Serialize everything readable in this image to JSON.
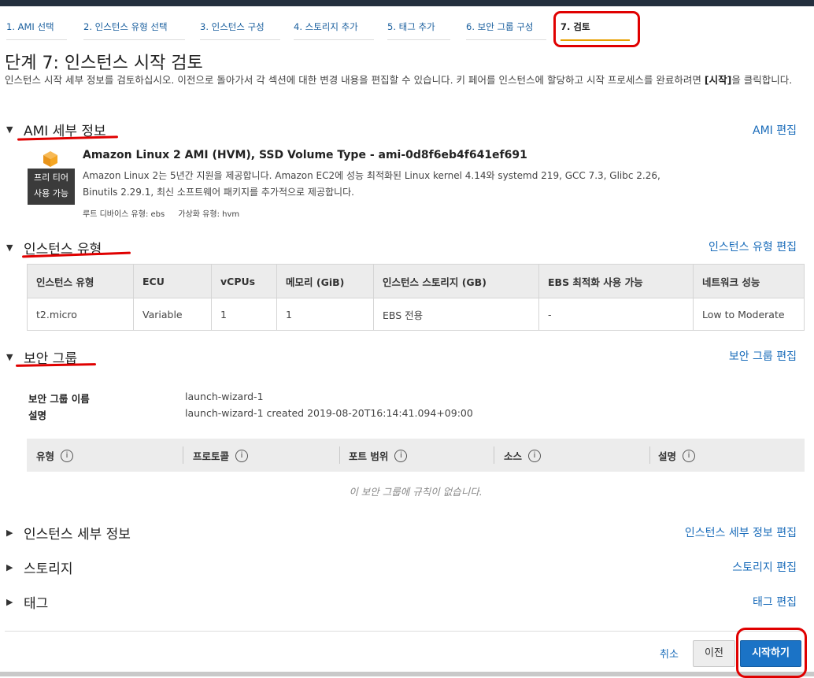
{
  "tabs": [
    {
      "label": "1. AMI 선택"
    },
    {
      "label": "2. 인스턴스 유형 선택"
    },
    {
      "label": "3. 인스턴스 구성"
    },
    {
      "label": "4. 스토리지 추가"
    },
    {
      "label": "5. 태그 추가"
    },
    {
      "label": "6. 보안 그룹 구성"
    },
    {
      "label": "7. 검토"
    }
  ],
  "page": {
    "title": "단계 7: 인스턴스 시작 검토",
    "desc_before": "인스턴스 시작 세부 정보를 검토하십시오. 이전으로 돌아가서 각 섹션에 대한 변경 내용을 편집할 수 있습니다. 키 페어를 인스턴스에 할당하고 시작 프로세스를 완료하려면 ",
    "desc_bold": "[시작]",
    "desc_after": "을 클릭합니다."
  },
  "ami": {
    "heading": "AMI 세부 정보",
    "edit": "AMI 편집",
    "name": "Amazon Linux 2 AMI (HVM), SSD Volume Type - ami-0d8f6eb4f641ef691",
    "free_line1": "프리 티어",
    "free_line2": "사용 가능",
    "description": "Amazon Linux 2는 5년간 지원을 제공합니다. Amazon EC2에 성능 최적화된 Linux kernel 4.14와 systemd 219, GCC 7.3, Glibc 2.26, Binutils 2.29.1, 최신 소프트웨어 패키지를 추가적으로 제공합니다.",
    "root_device": "루트 디바이스 유형: ebs",
    "virtualization": "가상화 유형: hvm"
  },
  "instance_type": {
    "heading": "인스턴스 유형",
    "edit": "인스턴스 유형 편집",
    "columns": [
      "인스턴스 유형",
      "ECU",
      "vCPUs",
      "메모리 (GiB)",
      "인스턴스 스토리지 (GB)",
      "EBS 최적화 사용 가능",
      "네트워크 성능"
    ],
    "row": [
      "t2.micro",
      "Variable",
      "1",
      "1",
      "EBS 전용",
      "-",
      "Low to Moderate"
    ]
  },
  "security": {
    "heading": "보안 그룹",
    "edit": "보안 그룹 편집",
    "name_label": "보안 그룹 이름",
    "name_value": "launch-wizard-1",
    "desc_label": "설명",
    "desc_value": "launch-wizard-1 created 2019-08-20T16:14:41.094+09:00",
    "rule_columns": [
      "유형",
      "프로토콜",
      "포트 범위",
      "소스",
      "설명"
    ],
    "info_glyph": "i",
    "no_rules": "이 보안 그룹에 규칙이 없습니다."
  },
  "collapsed_sections": [
    {
      "heading": "인스턴스 세부 정보",
      "edit": "인스턴스 세부 정보 편집"
    },
    {
      "heading": "스토리지",
      "edit": "스토리지 편집"
    },
    {
      "heading": "태그",
      "edit": "태그 편집"
    }
  ],
  "caret_down": "▼",
  "caret_right": "▶",
  "footer": {
    "cancel": "취소",
    "previous": "이전",
    "launch": "시작하기"
  },
  "colors": {
    "annotation": "#e00000",
    "link": "#1a6cba",
    "primary_button": "#1b73c6",
    "ami_icon": "#f5a623"
  }
}
